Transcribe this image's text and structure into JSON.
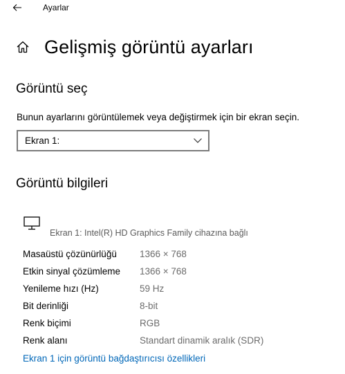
{
  "window": {
    "title": "Ayarlar"
  },
  "page": {
    "title": "Gelişmiş görüntü ayarları"
  },
  "select_display": {
    "heading": "Görüntü seç",
    "description": "Bunun ayarlarını görüntülemek veya değiştirmek için bir ekran seçin.",
    "selected": "Ekran 1:"
  },
  "display_info": {
    "heading": "Görüntü bilgileri",
    "adapter_line": "Ekran 1: Intel(R) HD Graphics Family cihazına bağlı",
    "rows": [
      {
        "label": "Masaüstü çözünürlüğü",
        "value": "1366 × 768"
      },
      {
        "label": "Etkin sinyal çözümleme",
        "value": "1366 × 768"
      },
      {
        "label": "Yenileme hızı (Hz)",
        "value": "59 Hz"
      },
      {
        "label": "Bit derinliği",
        "value": "8-bit"
      },
      {
        "label": "Renk biçimi",
        "value": "RGB"
      },
      {
        "label": "Renk alanı",
        "value": "Standart dinamik aralık (SDR)"
      }
    ],
    "link": "Ekran 1 için görüntü bağdaştırıcısı özellikleri"
  },
  "icons": {
    "back": "back-arrow-icon",
    "home": "home-icon",
    "monitor": "monitor-icon",
    "chevron": "chevron-down-icon"
  },
  "colors": {
    "link": "#0067b8",
    "secondary_text": "#6b6b6b",
    "select_border": "#7a7a7a"
  }
}
